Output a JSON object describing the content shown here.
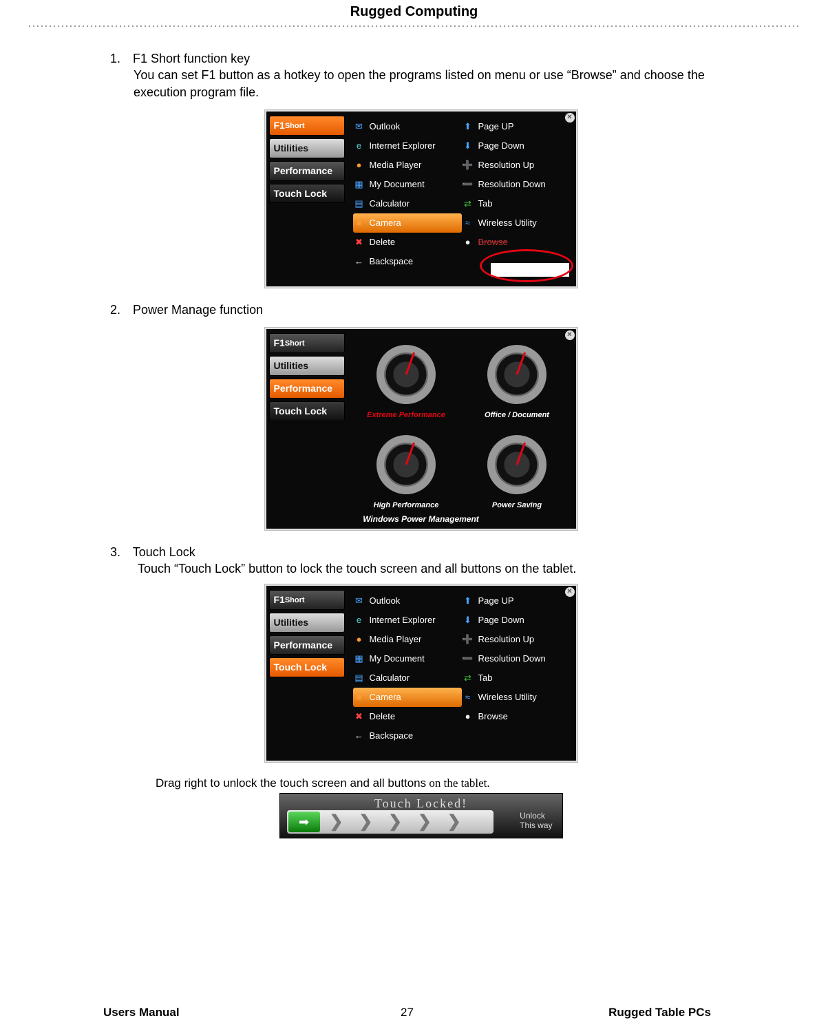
{
  "header": {
    "title": "Rugged  Computing"
  },
  "section1": {
    "num": "1.",
    "title": "F1 Short function key",
    "desc": "You can set F1 button as a hotkey to open the programs listed on menu or use “Browse” and choose the execution program file."
  },
  "section2": {
    "num": "2.",
    "title": "Power Manage function"
  },
  "section3": {
    "num": "3.",
    "title": "Touch Lock",
    "desc": "Touch “Touch Lock” button to lock the touch screen and all buttons on the tablet.",
    "drag_note_a": "Drag right to unlock the touch screen and all buttons",
    "drag_note_b": " on the tablet."
  },
  "tabs": {
    "f1_a": "F1",
    "f1_b": "Short",
    "utilities": "Utilities",
    "performance": "Performance",
    "touchlock": "Touch Lock"
  },
  "shortcuts_left": [
    {
      "icon": "✉",
      "cls": "i-blue",
      "label": "Outlook"
    },
    {
      "icon": "e",
      "cls": "i-cyan",
      "label": "Internet Explorer"
    },
    {
      "icon": "●",
      "cls": "i-orange",
      "label": "Media Player"
    },
    {
      "icon": "▦",
      "cls": "i-blue",
      "label": "My Document"
    },
    {
      "icon": "▤",
      "cls": "i-blue",
      "label": "Calculator"
    },
    {
      "icon": "■",
      "cls": "i-orange",
      "label": "Camera"
    },
    {
      "icon": "✖",
      "cls": "i-red",
      "label": "Delete"
    },
    {
      "icon": "←",
      "cls": "i-white",
      "label": "Backspace"
    }
  ],
  "shortcuts_right": [
    {
      "icon": "⬆",
      "cls": "i-blue",
      "label": "Page UP"
    },
    {
      "icon": "⬇",
      "cls": "i-blue",
      "label": "Page Down"
    },
    {
      "icon": "➕",
      "cls": "i-red",
      "label": "Resolution Up"
    },
    {
      "icon": "➖",
      "cls": "i-red",
      "label": "Resolution Down"
    },
    {
      "icon": "⇄",
      "cls": "i-green",
      "label": "Tab"
    },
    {
      "icon": "≈",
      "cls": "i-blue",
      "label": "Wireless Utility"
    },
    {
      "icon": "●",
      "cls": "i-white",
      "label": "Browse"
    }
  ],
  "shortcuts_right_nobrowse_last": {
    "icon": "●",
    "cls": "i-white",
    "label": "Browse"
  },
  "perf": {
    "g1": "Extreme Performance",
    "g2": "Office / Document",
    "g3": "High Performance",
    "g4": "Power Saving",
    "footer": "Windows Power Management"
  },
  "lockbar": {
    "title": "Touch  Locked!",
    "arrow": "➡",
    "chev": "❯ ❯ ❯ ❯ ❯",
    "unlock1": "Unlock",
    "unlock2": "This  way"
  },
  "footer": {
    "left": "Users Manual",
    "center": "27",
    "right": "Rugged Table PCs"
  }
}
